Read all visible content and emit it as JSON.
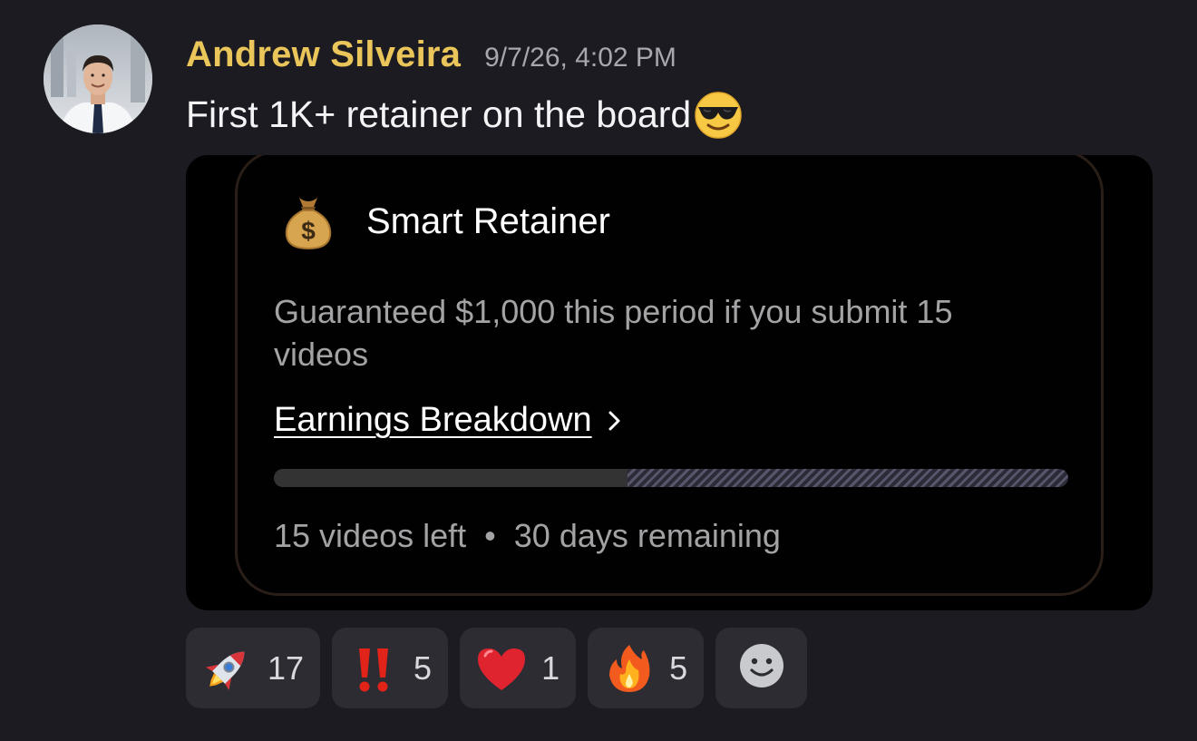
{
  "message": {
    "author": "Andrew Silveira",
    "timestamp": "9/7/26, 4:02 PM",
    "text": "First 1K+ retainer on the board",
    "text_emoji": "smiling-face-with-sunglasses-icon",
    "author_color": "#eac55a"
  },
  "attachment": {
    "title_icon": "money-bag-icon",
    "title": "Smart Retainer",
    "description": "Guaranteed $1,000 this period if you submit 15 videos",
    "link_label": "Earnings Breakdown",
    "link_icon": "chevron-right-icon",
    "progress_fraction": 0.445,
    "footer_videos": "15 videos left",
    "footer_separator": "•",
    "footer_days": "30 days remaining"
  },
  "reactions": [
    {
      "emoji": "rocket-icon",
      "count": "17"
    },
    {
      "emoji": "double-exclamation-icon",
      "count": "5"
    },
    {
      "emoji": "red-heart-icon",
      "count": "1"
    },
    {
      "emoji": "fire-icon",
      "count": "5"
    }
  ],
  "add_reaction_icon": "add-reaction-smiley-icon"
}
